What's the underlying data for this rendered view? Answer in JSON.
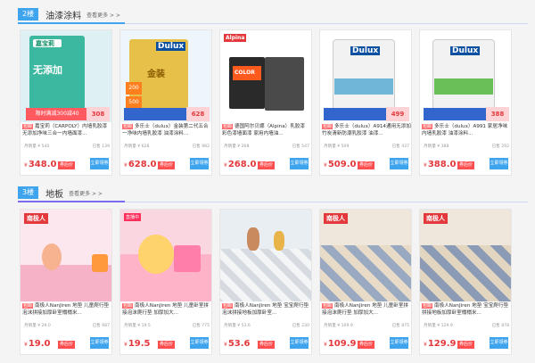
{
  "floors": [
    {
      "number": "2楼",
      "title": "油漆涂料",
      "more": "查看更多 > >",
      "items": [
        {
          "tag": "包邮",
          "title": "嘉宝莉（CARPOLY）内墙乳胶漆无添加净味三合一内墙面漆...",
          "stat_left": "月销量 ¥ 540",
          "stat_right": "已售 139",
          "price": "348.0",
          "coupon": "券后价",
          "buy": "立即领券",
          "brand": "嘉宝莉",
          "product": "无添加",
          "banner": "限时满减300减40",
          "price_box": "308"
        },
        {
          "tag": "包邮",
          "title": "多乐士（dulux）金装第二代五合一净味内墙乳胶漆 油漆涂料...",
          "stat_left": "月销量 ¥ 628",
          "stat_right": "已售 982",
          "price": "628.0",
          "coupon": "券后价",
          "buy": "立即领券",
          "brand": "Dulux",
          "product": "金装",
          "banner": "",
          "price_box": "628"
        },
        {
          "tag": "包邮",
          "title": "德国阿尔贝娜（Alpina）乳胶漆 彩色漆墙面漆 家用内墙油...",
          "stat_left": "月销量 ¥ 268",
          "stat_right": "已售 547",
          "price": "268.0",
          "coupon": "券后价",
          "buy": "立即领券",
          "brand": "Alpina",
          "product": "COLOR",
          "banner": "",
          "price_box": ""
        },
        {
          "tag": "包邮",
          "title": "多乐士（dulux）A914通用无添加竹炭清新防潮乳胶漆 油漆...",
          "stat_left": "月销量 ¥ 509",
          "stat_right": "已售 437",
          "price": "509.0",
          "coupon": "券后价",
          "buy": "立即领券",
          "brand": "Dulux",
          "product": "竹炭",
          "banner": "",
          "price_box": "499"
        },
        {
          "tag": "包邮",
          "title": "多乐士（dulux）A991 家居净味内墙乳胶漆 油漆涂料...",
          "stat_left": "月销量 ¥ 388",
          "stat_right": "已售 292",
          "price": "388.0",
          "coupon": "券后价",
          "buy": "立即领券",
          "brand": "Dulux",
          "product": "家居",
          "banner": "",
          "price_box": "388"
        }
      ]
    },
    {
      "number": "3楼",
      "title": "地板",
      "more": "查看更多 > >",
      "items": [
        {
          "tag": "包邮",
          "title": "南极人NanJiren 地垫 儿童爬行垫泡沫拼接加厚卧室榻榻米...",
          "stat_left": "月销量 ¥ 29.0",
          "stat_right": "已售 687",
          "price": "19.0",
          "coupon": "券后价",
          "buy": "立即领券",
          "brand": "南极人",
          "product": "",
          "banner": "",
          "price_box": ""
        },
        {
          "tag": "包邮",
          "title": "南极人NanJiren 地垫 儿童卧室拼接泡沫爬行垫 加厚加大...",
          "stat_left": "月销量 ¥ 19.5",
          "stat_right": "已售 775",
          "price": "19.5",
          "coupon": "券后价",
          "buy": "立即领券",
          "brand": "直播中",
          "product": "",
          "banner": "",
          "price_box": ""
        },
        {
          "tag": "包邮",
          "title": "南极人NanJiren 地垫 宝宝爬行垫泡沫拼接地板加厚卧室...",
          "stat_left": "月销量 ¥ 53.6",
          "stat_right": "已售 230",
          "price": "53.6",
          "coupon": "券后价",
          "buy": "立即领券",
          "brand": "",
          "product": "",
          "banner": "",
          "price_box": ""
        },
        {
          "tag": "包邮",
          "title": "南极人NanJiren 地垫 儿童卧室拼接泡沫爬行垫 加厚加大...",
          "stat_left": "月销量 ¥ 109.9",
          "stat_right": "已售 875",
          "price": "109.9",
          "coupon": "券后价",
          "buy": "立即领券",
          "brand": "南极人",
          "product": "",
          "banner": "",
          "price_box": ""
        },
        {
          "tag": "包邮",
          "title": "南极人NanJiren 地垫 宝宝爬行垫拼接地板加厚卧室榻榻米...",
          "stat_left": "月销量 ¥ 129.9",
          "stat_right": "已售 878",
          "price": "129.9",
          "coupon": "券后价",
          "buy": "立即领券",
          "brand": "南极人",
          "product": "",
          "banner": "",
          "price_box": ""
        }
      ]
    }
  ],
  "colors": {
    "accent": "#3ea4ee",
    "price": "#e4393c",
    "coupon": "#ff4e50",
    "tag": "#ff6a6a"
  }
}
